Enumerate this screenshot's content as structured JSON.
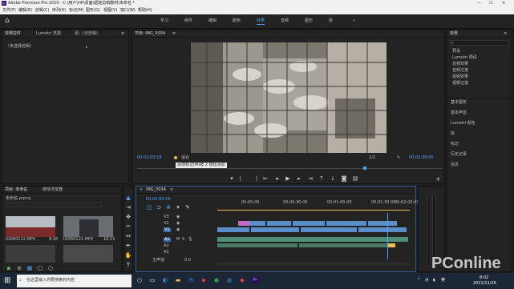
{
  "app": {
    "title": "Adobe Premiere Pro 2020 - C:\\用户\\HP\\桌面\\超能剪辑教材\\未命名 *",
    "window_controls": [
      "—",
      "☐",
      "✕"
    ]
  },
  "menu": [
    "文件(F)",
    "编辑(E)",
    "剪辑(C)",
    "序列(S)",
    "标记(M)",
    "图形(G)",
    "视图(V)",
    "窗口(W)",
    "帮助(H)"
  ],
  "workspaces": [
    "学习",
    "组件",
    "编辑",
    "颜色",
    "效果",
    "音频",
    "图形",
    "库"
  ],
  "active_workspace": "颜色",
  "source_panel": {
    "tabs": [
      "效果控件",
      "Lumetri 范围",
      "源：(无剪辑)"
    ],
    "no_clip_text": "（未选择剪辑）"
  },
  "program_monitor": {
    "title": "节目: IMG_0034",
    "timecode_current": "00:02:03:18",
    "fit": "适合",
    "page": "1/2",
    "timecode_total": "00:02:38:06",
    "tooltip": "添加标记(M)按 2 按钮添加"
  },
  "project_panel": {
    "tabs": [
      "项目: 未命名",
      "媒体浏览器"
    ],
    "search_placeholder": "未命名.prproj",
    "items": [
      {
        "name": "IGAR0113.MP4",
        "dur": "8:26"
      },
      {
        "name": "IGAR0121.MP4",
        "dur": "18:15"
      },
      {
        "name": "",
        "dur": ""
      },
      {
        "name": "",
        "dur": ""
      }
    ]
  },
  "timeline": {
    "tab": "IMG_0034",
    "timecode": "00:02:03:18",
    "ruler": [
      "00:00:00",
      "00:00:30:00",
      "00:01:00:00",
      "00:01:30:00",
      "00:02:00:00"
    ],
    "tracks_video": [
      "V3",
      "V2",
      "V1"
    ],
    "tracks_audio": [
      "A1",
      "A2",
      "A3"
    ],
    "master": "主声道",
    "master_value": "0.0"
  },
  "right_panel": {
    "title": "效果",
    "tree": [
      "预设",
      "Lumetri 预设",
      "音频效果",
      "音频过渡",
      "视频效果",
      "视频过渡"
    ],
    "sections": [
      "基本图形",
      "基本声音",
      "Lumetri 颜色",
      "库",
      "标记",
      "历史记录",
      "信息"
    ]
  },
  "taskbar": {
    "search_placeholder": "在这里输入你要搜索的内容",
    "tray_lang": "英",
    "time": "8:02",
    "date": "2021/11/26"
  },
  "watermark": "PConline",
  "colors": {
    "accent_blue": "#4aa3ff",
    "timecode_yellow": "#e8c04a",
    "video_clip": "#5b8fc9",
    "audio_clip": "#4f8f77",
    "pink_clip": "#c66ac8"
  }
}
